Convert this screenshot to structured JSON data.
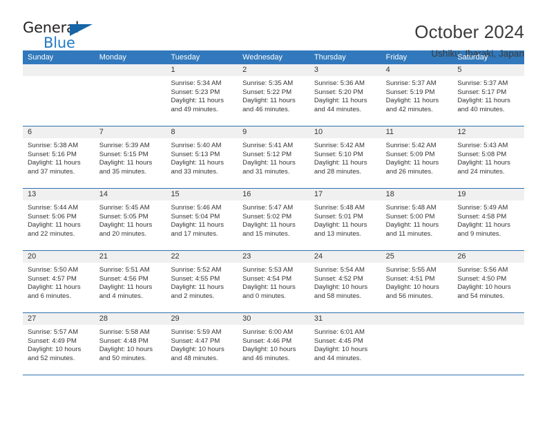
{
  "logo": {
    "word1": "General",
    "word2": "Blue",
    "triangle_color": "#1565a8",
    "blue": "#2079c4"
  },
  "header": {
    "title": "October 2024",
    "subtitle": "Ushiku, Ibaraki, Japan",
    "accent_color": "#3179bc",
    "date_band_color": "#f0f0f0"
  },
  "weekdays": [
    "Sunday",
    "Monday",
    "Tuesday",
    "Wednesday",
    "Thursday",
    "Friday",
    "Saturday"
  ],
  "weeks": [
    [
      {
        "day": "",
        "lines": []
      },
      {
        "day": "",
        "lines": []
      },
      {
        "day": "1",
        "lines": [
          "Sunrise: 5:34 AM",
          "Sunset: 5:23 PM",
          "Daylight: 11 hours",
          "and 49 minutes."
        ]
      },
      {
        "day": "2",
        "lines": [
          "Sunrise: 5:35 AM",
          "Sunset: 5:22 PM",
          "Daylight: 11 hours",
          "and 46 minutes."
        ]
      },
      {
        "day": "3",
        "lines": [
          "Sunrise: 5:36 AM",
          "Sunset: 5:20 PM",
          "Daylight: 11 hours",
          "and 44 minutes."
        ]
      },
      {
        "day": "4",
        "lines": [
          "Sunrise: 5:37 AM",
          "Sunset: 5:19 PM",
          "Daylight: 11 hours",
          "and 42 minutes."
        ]
      },
      {
        "day": "5",
        "lines": [
          "Sunrise: 5:37 AM",
          "Sunset: 5:17 PM",
          "Daylight: 11 hours",
          "and 40 minutes."
        ]
      }
    ],
    [
      {
        "day": "6",
        "lines": [
          "Sunrise: 5:38 AM",
          "Sunset: 5:16 PM",
          "Daylight: 11 hours",
          "and 37 minutes."
        ]
      },
      {
        "day": "7",
        "lines": [
          "Sunrise: 5:39 AM",
          "Sunset: 5:15 PM",
          "Daylight: 11 hours",
          "and 35 minutes."
        ]
      },
      {
        "day": "8",
        "lines": [
          "Sunrise: 5:40 AM",
          "Sunset: 5:13 PM",
          "Daylight: 11 hours",
          "and 33 minutes."
        ]
      },
      {
        "day": "9",
        "lines": [
          "Sunrise: 5:41 AM",
          "Sunset: 5:12 PM",
          "Daylight: 11 hours",
          "and 31 minutes."
        ]
      },
      {
        "day": "10",
        "lines": [
          "Sunrise: 5:42 AM",
          "Sunset: 5:10 PM",
          "Daylight: 11 hours",
          "and 28 minutes."
        ]
      },
      {
        "day": "11",
        "lines": [
          "Sunrise: 5:42 AM",
          "Sunset: 5:09 PM",
          "Daylight: 11 hours",
          "and 26 minutes."
        ]
      },
      {
        "day": "12",
        "lines": [
          "Sunrise: 5:43 AM",
          "Sunset: 5:08 PM",
          "Daylight: 11 hours",
          "and 24 minutes."
        ]
      }
    ],
    [
      {
        "day": "13",
        "lines": [
          "Sunrise: 5:44 AM",
          "Sunset: 5:06 PM",
          "Daylight: 11 hours",
          "and 22 minutes."
        ]
      },
      {
        "day": "14",
        "lines": [
          "Sunrise: 5:45 AM",
          "Sunset: 5:05 PM",
          "Daylight: 11 hours",
          "and 20 minutes."
        ]
      },
      {
        "day": "15",
        "lines": [
          "Sunrise: 5:46 AM",
          "Sunset: 5:04 PM",
          "Daylight: 11 hours",
          "and 17 minutes."
        ]
      },
      {
        "day": "16",
        "lines": [
          "Sunrise: 5:47 AM",
          "Sunset: 5:02 PM",
          "Daylight: 11 hours",
          "and 15 minutes."
        ]
      },
      {
        "day": "17",
        "lines": [
          "Sunrise: 5:48 AM",
          "Sunset: 5:01 PM",
          "Daylight: 11 hours",
          "and 13 minutes."
        ]
      },
      {
        "day": "18",
        "lines": [
          "Sunrise: 5:48 AM",
          "Sunset: 5:00 PM",
          "Daylight: 11 hours",
          "and 11 minutes."
        ]
      },
      {
        "day": "19",
        "lines": [
          "Sunrise: 5:49 AM",
          "Sunset: 4:58 PM",
          "Daylight: 11 hours",
          "and 9 minutes."
        ]
      }
    ],
    [
      {
        "day": "20",
        "lines": [
          "Sunrise: 5:50 AM",
          "Sunset: 4:57 PM",
          "Daylight: 11 hours",
          "and 6 minutes."
        ]
      },
      {
        "day": "21",
        "lines": [
          "Sunrise: 5:51 AM",
          "Sunset: 4:56 PM",
          "Daylight: 11 hours",
          "and 4 minutes."
        ]
      },
      {
        "day": "22",
        "lines": [
          "Sunrise: 5:52 AM",
          "Sunset: 4:55 PM",
          "Daylight: 11 hours",
          "and 2 minutes."
        ]
      },
      {
        "day": "23",
        "lines": [
          "Sunrise: 5:53 AM",
          "Sunset: 4:54 PM",
          "Daylight: 11 hours",
          "and 0 minutes."
        ]
      },
      {
        "day": "24",
        "lines": [
          "Sunrise: 5:54 AM",
          "Sunset: 4:52 PM",
          "Daylight: 10 hours",
          "and 58 minutes."
        ]
      },
      {
        "day": "25",
        "lines": [
          "Sunrise: 5:55 AM",
          "Sunset: 4:51 PM",
          "Daylight: 10 hours",
          "and 56 minutes."
        ]
      },
      {
        "day": "26",
        "lines": [
          "Sunrise: 5:56 AM",
          "Sunset: 4:50 PM",
          "Daylight: 10 hours",
          "and 54 minutes."
        ]
      }
    ],
    [
      {
        "day": "27",
        "lines": [
          "Sunrise: 5:57 AM",
          "Sunset: 4:49 PM",
          "Daylight: 10 hours",
          "and 52 minutes."
        ]
      },
      {
        "day": "28",
        "lines": [
          "Sunrise: 5:58 AM",
          "Sunset: 4:48 PM",
          "Daylight: 10 hours",
          "and 50 minutes."
        ]
      },
      {
        "day": "29",
        "lines": [
          "Sunrise: 5:59 AM",
          "Sunset: 4:47 PM",
          "Daylight: 10 hours",
          "and 48 minutes."
        ]
      },
      {
        "day": "30",
        "lines": [
          "Sunrise: 6:00 AM",
          "Sunset: 4:46 PM",
          "Daylight: 10 hours",
          "and 46 minutes."
        ]
      },
      {
        "day": "31",
        "lines": [
          "Sunrise: 6:01 AM",
          "Sunset: 4:45 PM",
          "Daylight: 10 hours",
          "and 44 minutes."
        ]
      },
      {
        "day": "",
        "lines": []
      },
      {
        "day": "",
        "lines": []
      }
    ]
  ]
}
